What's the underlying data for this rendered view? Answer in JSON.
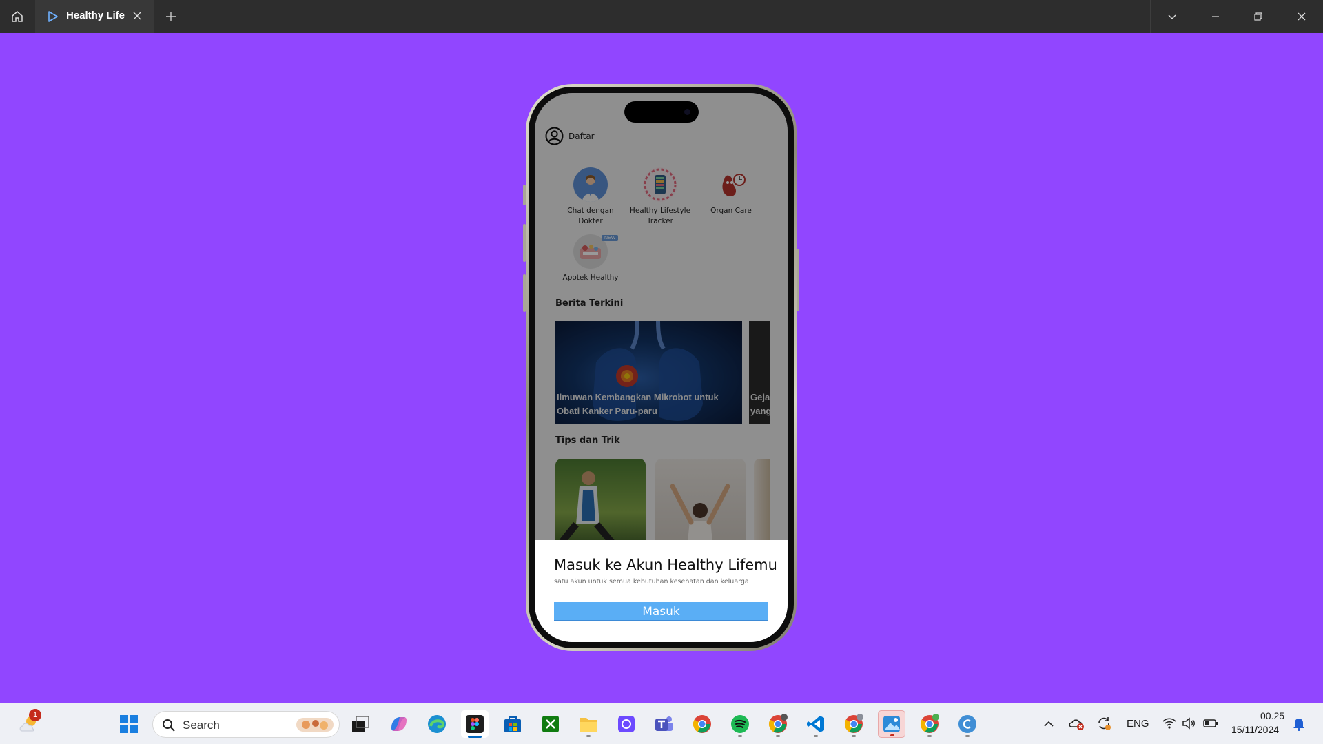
{
  "window": {
    "tab_title": "Healthy Life"
  },
  "app": {
    "account_label": "Daftar",
    "features": [
      {
        "label": "Chat  dengan Dokter",
        "icon": "doctor-icon"
      },
      {
        "label": "Healthy Lifestyle Tracker",
        "icon": "lifestyle-tracker-icon"
      },
      {
        "label": "Organ Care",
        "icon": "organ-care-icon"
      },
      {
        "label": "Apotek Healthy",
        "icon": "pharmacy-icon",
        "badge": "NEW"
      }
    ],
    "news_section_title": "Berita Terkini",
    "news": [
      {
        "title": "Ilmuwan Kembangkan Mikrobot untuk Obati Kanker Paru-paru"
      },
      {
        "title": "Geja yang"
      }
    ],
    "tips_section_title": "Tips dan Trik",
    "sheet": {
      "title": "Masuk ke Akun Healthy Lifemu",
      "subtitle": "satu akun untuk semua kebutuhan kesehatan dan keluarga",
      "button_label": "Masuk"
    }
  },
  "taskbar": {
    "search_label": "Search",
    "weather_badge": "1",
    "language": "ENG",
    "time": "00.25",
    "date": "15/11/2024",
    "apps": [
      "start-icon",
      "task-view-icon",
      "copilot-icon",
      "edge-icon",
      "figma-icon",
      "store-icon",
      "xbox-icon",
      "file-explorer-icon",
      "proton-icon",
      "teams-icon",
      "chrome-icon",
      "spotify-icon",
      "chrome-profile-icon",
      "vscode-icon",
      "chrome-profile-c-icon",
      "photos-icon",
      "chrome-profile-s-icon",
      "canva-icon"
    ]
  },
  "colors": {
    "background": "#9146ff",
    "button": "#5aaef5"
  }
}
